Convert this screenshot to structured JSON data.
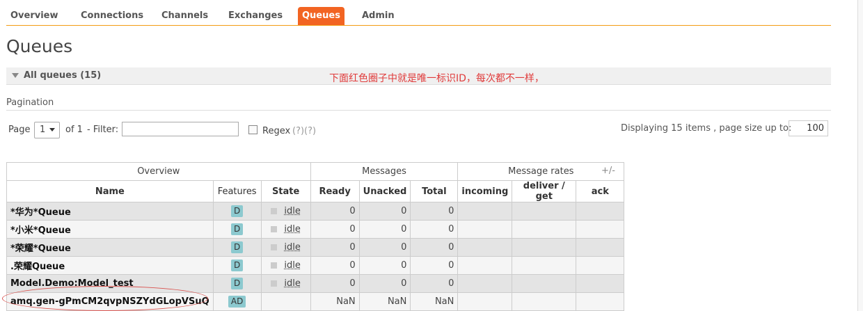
{
  "nav": {
    "tabs": [
      {
        "label": "Overview",
        "active": false
      },
      {
        "label": "Connections",
        "active": false
      },
      {
        "label": "Channels",
        "active": false
      },
      {
        "label": "Exchanges",
        "active": false
      },
      {
        "label": "Queues",
        "active": true
      },
      {
        "label": "Admin",
        "active": false
      }
    ]
  },
  "page_title": "Queues",
  "section": {
    "label": "All queues (15)"
  },
  "annotation": "下面红色圈子中就是唯一标识ID，每次都不一样，",
  "pagination": {
    "label": "Pagination",
    "page_label": "Page",
    "page_value": "1",
    "of_label": "of 1",
    "filter_label": "- Filter:",
    "filter_value": "",
    "regex_label": "Regex",
    "regex_help": "(?)(?)",
    "display_text": "Displaying 15 items , page size up to:",
    "page_size": "100"
  },
  "table": {
    "group_headers": {
      "overview": "Overview",
      "messages": "Messages",
      "rates": "Message rates"
    },
    "plus_minus": "+/-",
    "columns": {
      "name": "Name",
      "features": "Features",
      "state": "State",
      "ready": "Ready",
      "unacked": "Unacked",
      "total": "Total",
      "incoming": "incoming",
      "deliver": "deliver / get",
      "ack": "ack"
    },
    "rows": [
      {
        "name": "*华为*Queue",
        "features": "D",
        "state": "idle",
        "ready": "0",
        "unacked": "0",
        "total": "0"
      },
      {
        "name": "*小米*Queue",
        "features": "D",
        "state": "idle",
        "ready": "0",
        "unacked": "0",
        "total": "0"
      },
      {
        "name": "*荣耀*Queue",
        "features": "D",
        "state": "idle",
        "ready": "0",
        "unacked": "0",
        "total": "0"
      },
      {
        "name": ".荣耀Queue",
        "features": "D",
        "state": "idle",
        "ready": "0",
        "unacked": "0",
        "total": "0"
      },
      {
        "name": "Model.Demo:Model_test",
        "features": "D",
        "state": "idle",
        "ready": "0",
        "unacked": "0",
        "total": "0"
      },
      {
        "name": "amq.gen-gPmCM2qvpNSZYdGLopVSuQ",
        "features": "AD",
        "state": "",
        "ready": "NaN",
        "unacked": "NaN",
        "total": "NaN"
      }
    ]
  }
}
